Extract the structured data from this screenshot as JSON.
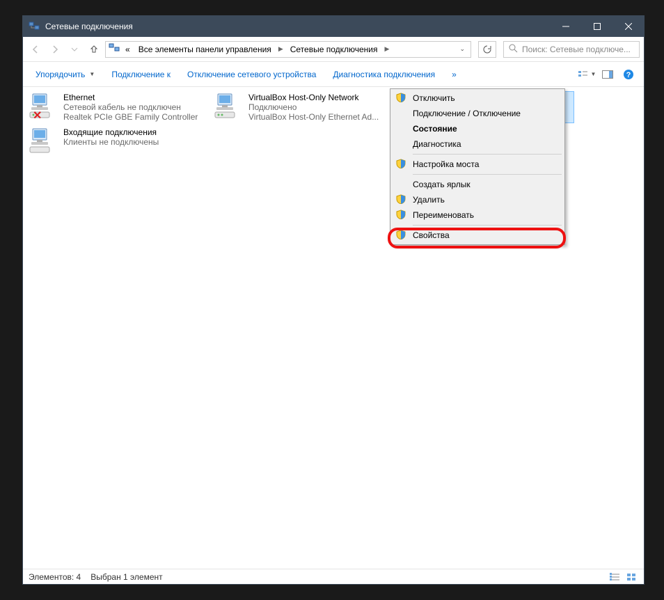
{
  "title": "Сетевые подключения",
  "breadcrumbs": [
    "Все элементы панели управления",
    "Сетевые подключения"
  ],
  "search_placeholder": "Поиск: Сетевые подключе...",
  "commands": {
    "organize": "Упорядочить",
    "connect_to": "Подключение к",
    "disable_device": "Отключение сетевого устройства",
    "diagnose": "Диагностика подключения",
    "more": "»"
  },
  "adapters": [
    {
      "name": "Ethernet",
      "status": "Сетевой кабель не подключен",
      "device": "Realtek PCIe GBE Family Controller",
      "state": "disconnected"
    },
    {
      "name": "VirtualBox Host-Only Network",
      "status": "Подключено",
      "device": "VirtualBox Host-Only Ethernet Ad...",
      "state": "connected"
    },
    {
      "name": "",
      "status": "",
      "device": "",
      "state": "selected"
    },
    {
      "name": "Входящие подключения",
      "status": "Клиенты не подключены",
      "device": "",
      "state": "incoming"
    }
  ],
  "context_menu": [
    {
      "label": "Отключить",
      "shield": true
    },
    {
      "label": "Подключение / Отключение",
      "shield": false
    },
    {
      "label": "Состояние",
      "shield": false,
      "bold": true
    },
    {
      "label": "Диагностика",
      "shield": false
    },
    {
      "sep": true
    },
    {
      "label": "Настройка моста",
      "shield": true
    },
    {
      "sep": true
    },
    {
      "label": "Создать ярлык",
      "shield": false
    },
    {
      "label": "Удалить",
      "shield": true
    },
    {
      "label": "Переименовать",
      "shield": true
    },
    {
      "sep": true
    },
    {
      "label": "Свойства",
      "shield": true
    }
  ],
  "statusbar": {
    "count": "Элементов: 4",
    "selection": "Выбран 1 элемент"
  }
}
